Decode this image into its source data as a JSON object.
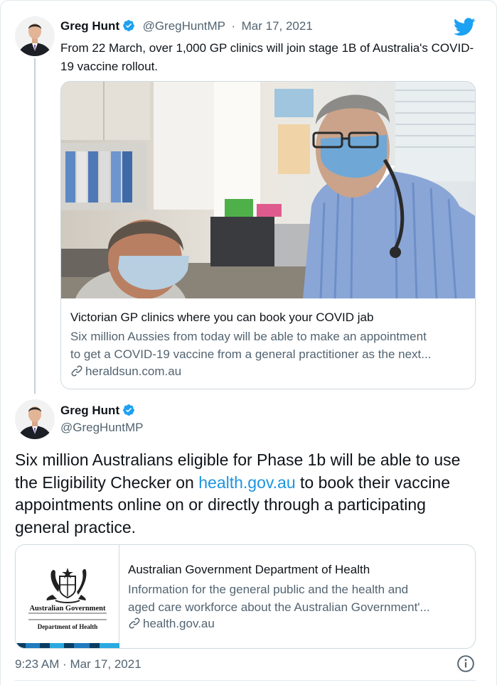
{
  "quoted_tweet": {
    "author_name": "Greg Hunt",
    "author_handle": "@GregHuntMP",
    "separator": "·",
    "date": "Mar 17, 2021",
    "text": "From 22 March, over 1,000 GP clinics will join stage 1B of Australia's COVID-19 vaccine rollout.",
    "card": {
      "title": "Victorian GP clinics where you can book your COVID jab",
      "description_line1": "Six million Aussies from today will be able to make an appointment",
      "description_line2": "to get a COVID-19 vaccine from a general practitioner as the next...",
      "domain": "heraldsun.com.au"
    }
  },
  "main_tweet": {
    "author_name": "Greg Hunt",
    "author_handle": "@GregHuntMP",
    "text_before": "Six million Australians eligible for Phase 1b will be able to use the Eligibility Checker on ",
    "text_link": "health.gov.au",
    "text_after": " to book their vaccine appointments online on or directly through a participating general practice.",
    "card": {
      "logo_line1": "Australian Government",
      "logo_line2": "Department of Health",
      "title": "Australian Government Department of Health",
      "description_line1": "Information for the general public and the health and",
      "description_line2": "aged care workforce about the Australian Government'...",
      "domain": "health.gov.au"
    },
    "timestamp": "9:23 AM · Mar 17, 2021"
  },
  "icons": {
    "brand": "twitter-bird-icon",
    "verified": "verified-badge-icon",
    "link": "link-icon",
    "info": "info-icon"
  },
  "colors": {
    "twitter_blue": "#1da1f2",
    "link_blue": "#1b95e0",
    "secondary_text": "#536471",
    "border": "#cfd9de"
  }
}
